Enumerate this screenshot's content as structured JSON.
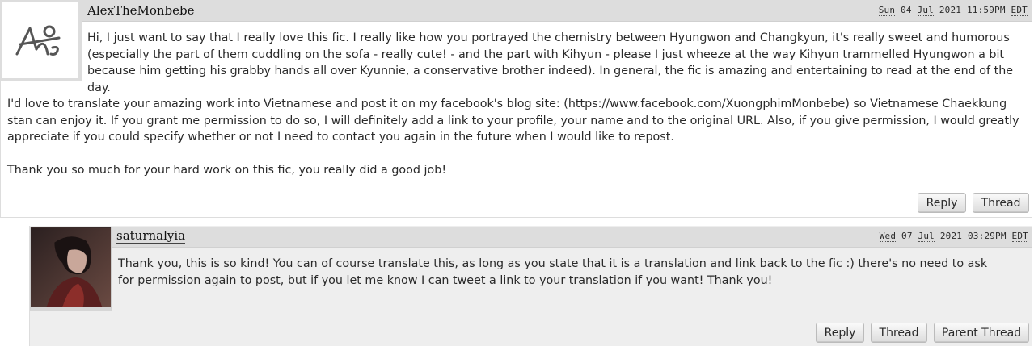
{
  "comments": [
    {
      "author": "AlexTheMonbebe",
      "datetime": {
        "weekday": "Sun",
        "day": "04",
        "month": "Jul",
        "year": "2021",
        "time": "11:59PM",
        "timezone": "EDT"
      },
      "avatar_icon": "monbebe-logo-icon",
      "paragraphs": [
        "Hi, I just want to say that I really love this fic. I really like how you portrayed the chemistry between Hyungwon and Changkyun, it's really sweet and humorous (especially the part of them cuddling on the sofa - really cute! - and the part with Kihyun - please I just wheeze at the way Kihyun trammelled Hyungwon a bit because him getting his grabby hands all over Kyunnie, a conservative brother indeed). In general, the fic is amazing and entertaining to read at the end of the day.",
        "I'd love to translate your amazing work into Vietnamese and post it on my facebook's blog site: (https://www.facebook.com/XuongphimMonbebe) so Vietnamese Chaekkung stan can enjoy it. If you grant me permission to do so, I will definitely add a link to your profile, your name and to the original URL. Also, if you give permission, I would greatly appreciate if you could specify whether or not I need to contact you again in the future when I would like to repost.",
        "Thank you so much for your hard work on this fic, you really did a good job!"
      ],
      "actions": [
        "Reply",
        "Thread"
      ]
    },
    {
      "author": "saturnalyia",
      "datetime": {
        "weekday": "Wed",
        "day": "07",
        "month": "Jul",
        "year": "2021",
        "time": "03:29PM",
        "timezone": "EDT"
      },
      "avatar_icon": "user-portrait-avatar",
      "paragraphs": [
        "Thank you, this is so kind! You can of course translate this, as long as you state that it is a translation and link back to the fic :) there's no need to ask for permission again to post, but if you let me know I can tweet a link to your translation if you want! Thank you!"
      ],
      "actions": [
        "Reply",
        "Thread",
        "Parent Thread"
      ]
    }
  ],
  "colors": {
    "header_bg": "#dddddd",
    "reply_bg": "#eeeeee",
    "text": "#2a2a2a"
  }
}
